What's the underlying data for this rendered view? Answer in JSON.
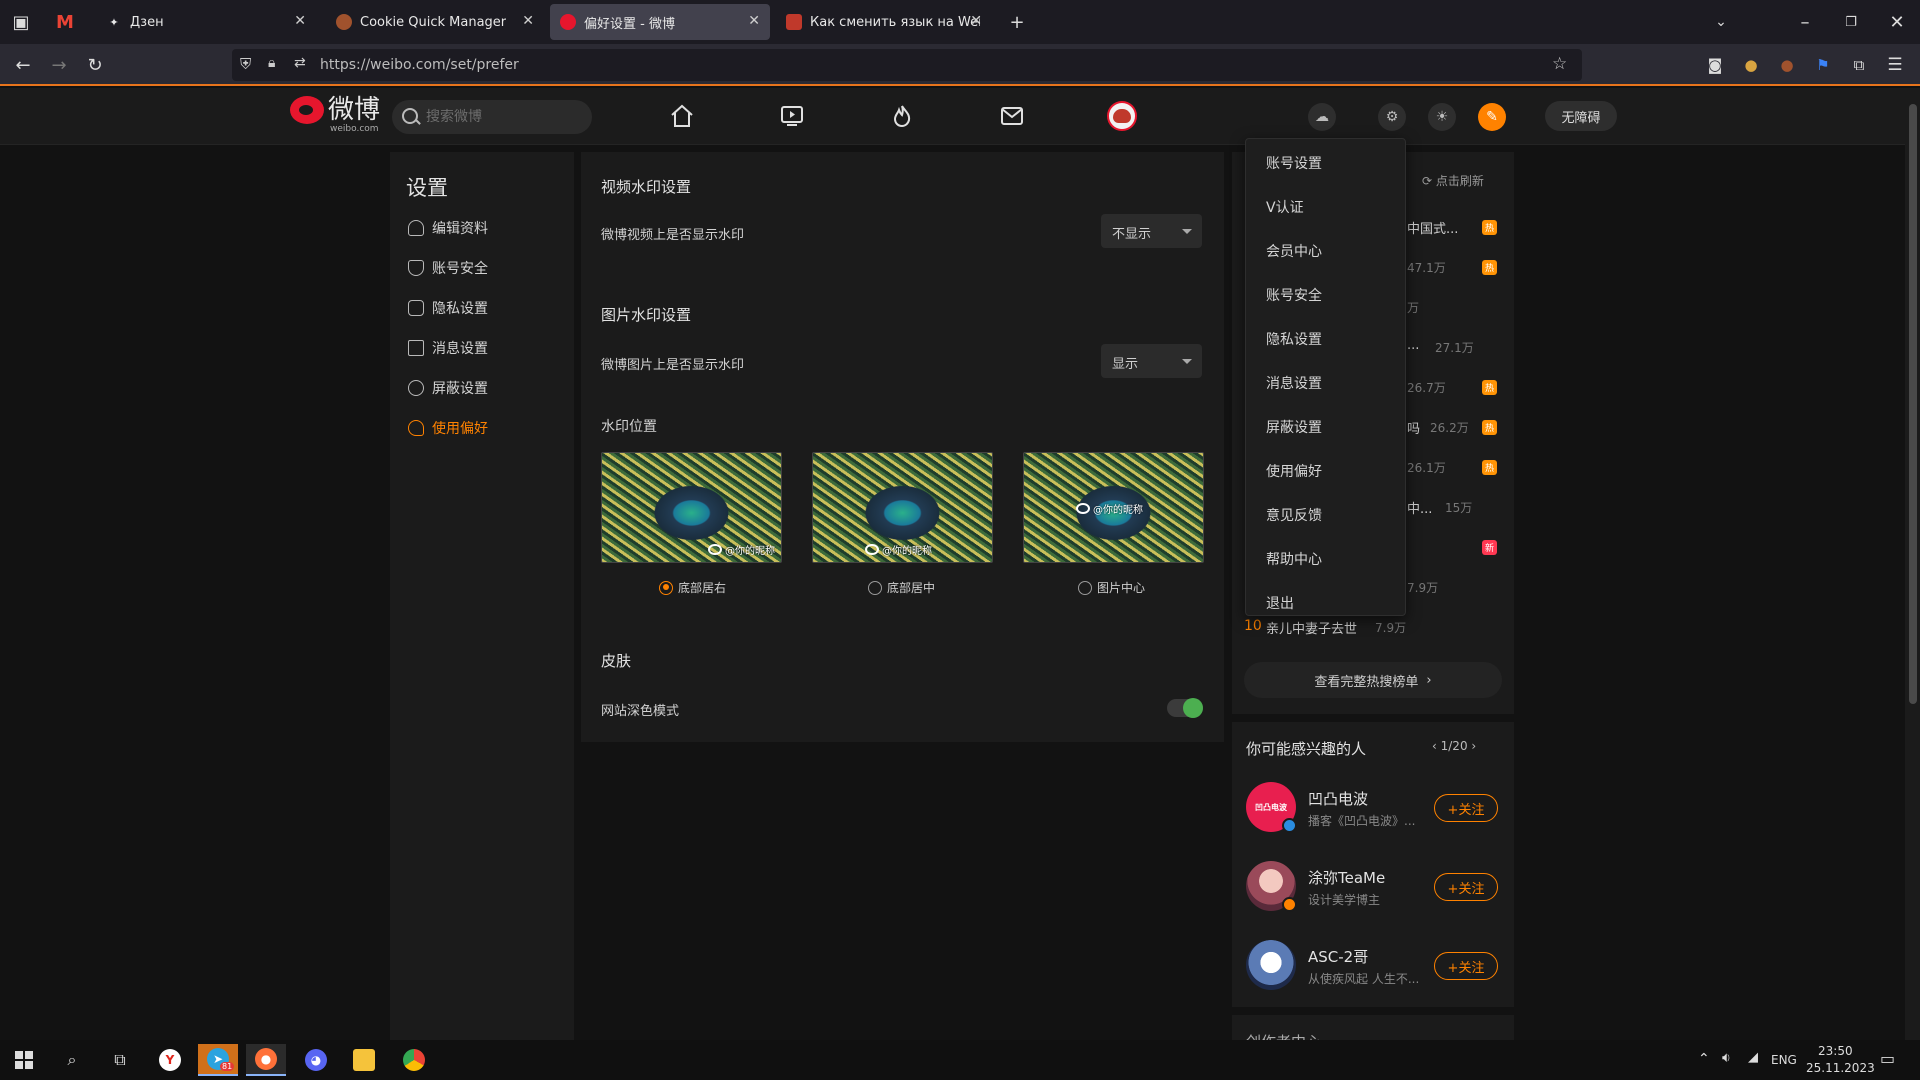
{
  "browser": {
    "tabs": [
      {
        "title": "Дзен",
        "icon": "zen-icon"
      },
      {
        "title": "Cookie Quick Manager",
        "icon": "cookie-icon"
      },
      {
        "title": "偏好设置 - 微博",
        "icon": "weibo-icon"
      },
      {
        "title": "Как сменить язык на Weibo - I",
        "icon": "article-icon"
      }
    ],
    "url": "https://weibo.com/set/prefer"
  },
  "weibo_header": {
    "logo_text": "微博",
    "logo_sub": "weibo.com",
    "search_placeholder": "搜索微博",
    "accessible_label": "无障碍"
  },
  "sidebar": {
    "title": "设置",
    "items": [
      {
        "label": "编辑资料"
      },
      {
        "label": "账号安全"
      },
      {
        "label": "隐私设置"
      },
      {
        "label": "消息设置"
      },
      {
        "label": "屏蔽设置"
      },
      {
        "label": "使用偏好"
      }
    ]
  },
  "main": {
    "video_wm_title": "视频水印设置",
    "video_wm_label": "微博视频上是否显示水印",
    "video_wm_value": "不显示",
    "image_wm_title": "图片水印设置",
    "image_wm_label": "微博图片上是否显示水印",
    "image_wm_value": "显示",
    "position_title": "水印位置",
    "watermark_text": "@你的昵称",
    "positions": [
      {
        "label": "底部居右"
      },
      {
        "label": "底部居中"
      },
      {
        "label": "图片中心"
      }
    ],
    "selected_position": "底部居右",
    "skin_title": "皮肤",
    "dark_mode_label": "网站深色模式",
    "dark_mode_on": true
  },
  "hot_search": {
    "refresh_label": "点击刷新",
    "fragments": [
      {
        "text": "中国式...",
        "count": "",
        "badge": "热"
      },
      {
        "text": "",
        "count": "47.1万",
        "badge": "热"
      },
      {
        "text": "",
        "count": "万",
        "badge": ""
      },
      {
        "text": "...",
        "count": "27.1万",
        "badge": ""
      },
      {
        "text": "",
        "count": "26.7万",
        "badge": "热"
      },
      {
        "text": "吗",
        "count": "26.2万",
        "badge": "热"
      },
      {
        "text": "",
        "count": "26.1万",
        "badge": "热"
      },
      {
        "text": "中...",
        "count": "15万",
        "badge": ""
      },
      {
        "text": "",
        "count": "",
        "badge": "新"
      },
      {
        "text": "",
        "count": "7.9万",
        "badge": ""
      }
    ],
    "item10_rank": "10",
    "item10_text": "亲儿中妻子去世",
    "item10_count": "7.9万",
    "full_rank_label": "查看完整热搜榜单"
  },
  "suggestions": {
    "title": "你可能感兴趣的人",
    "pager": "1/20",
    "follow_label": "+关注",
    "people": [
      {
        "name": "凹凸电波",
        "desc": "播客《凹凸电波》...",
        "avatar_text": "凹凸电波"
      },
      {
        "name": "涂弥TeaMe",
        "desc": "设计美学博主",
        "avatar_text": ""
      },
      {
        "name": "ASC-2哥",
        "desc": "从使疾风起 人生不...",
        "avatar_text": ""
      }
    ],
    "creator_title": "创作者中心"
  },
  "dropdown": {
    "items": [
      "账号设置",
      "V认证",
      "会员中心",
      "账号安全",
      "隐私设置",
      "消息设置",
      "屏蔽设置",
      "使用偏好",
      "意见反馈",
      "帮助中心",
      "退出"
    ]
  },
  "taskbar": {
    "lang": "ENG",
    "time": "23:50",
    "date": "25.11.2023",
    "telegram_badge": "81"
  },
  "colors": {
    "accent": "#ff8200",
    "toggle_on": "#4caf50",
    "hot_badge": "#ff9406",
    "new_badge": "#ff3852"
  }
}
